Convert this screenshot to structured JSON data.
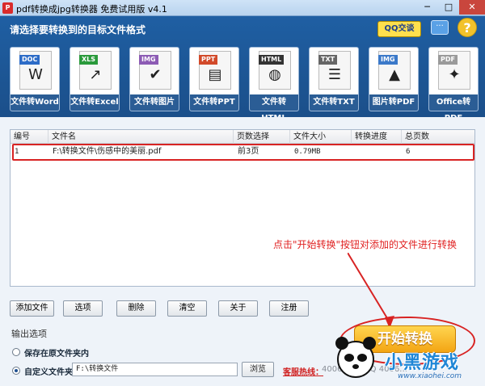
{
  "window": {
    "title": "pdf转换成jpg转换器 免费试用版 v4.1",
    "app_icon": "pdf-app-icon",
    "minimize": "─",
    "maximize": "□",
    "close": "✕"
  },
  "header": {
    "prompt": "请选择要转换到的目标文件格式",
    "qq_button": "QQ交谈",
    "chat_icon": "speech-bubble-icon",
    "help_icon": "question-icon",
    "help_glyph": "?",
    "formats": [
      {
        "label": "文件转Word",
        "tag": "DOC",
        "tag_color": "#2d6cc7",
        "icon": "word-doc-icon",
        "glyph": "W"
      },
      {
        "label": "文件转Excel",
        "tag": "XLS",
        "tag_color": "#2a9a3b",
        "icon": "excel-chart-icon",
        "glyph": "↗"
      },
      {
        "label": "文件转图片",
        "tag": "IMG",
        "tag_color": "#8c5bb4",
        "icon": "image-check-icon",
        "glyph": "✔"
      },
      {
        "label": "文件转PPT",
        "tag": "PPT",
        "tag_color": "#d24a2a",
        "icon": "ppt-slide-icon",
        "glyph": "▤"
      },
      {
        "label": "文件转HTML",
        "tag": "HTML",
        "tag_color": "#333333",
        "icon": "html-globe-icon",
        "glyph": "◍"
      },
      {
        "label": "文件转TXT",
        "tag": "TXT",
        "tag_color": "#666666",
        "icon": "txt-document-icon",
        "glyph": "☰"
      },
      {
        "label": "图片转PDF",
        "tag": "IMG",
        "tag_color": "#3b79c9",
        "icon": "image-to-pdf-icon",
        "glyph": "▲"
      },
      {
        "label": "Office转PDF",
        "tag": "PDF",
        "tag_color": "#9a9a9a",
        "icon": "office-to-pdf-icon",
        "glyph": "✦"
      }
    ]
  },
  "table": {
    "columns": [
      "编号",
      "文件名",
      "页数选择",
      "文件大小",
      "转换进度",
      "总页数"
    ],
    "rows": [
      {
        "id": "1",
        "filename": "F:\\转换文件\\伤感中的美丽.pdf",
        "pages": "前3页",
        "size": "0.79MB",
        "progress": "",
        "total": "6"
      }
    ]
  },
  "annotation": "点击\"开始转换\"按钮对添加的文件进行转换",
  "buttons": {
    "add": "添加文件",
    "options": "选项",
    "delete": "删除",
    "clear": "清空",
    "about": "关于",
    "register": "注册",
    "browse": "浏览",
    "start": "开始转换"
  },
  "output": {
    "title": "输出选项",
    "option_original": "保存在原文件夹内",
    "option_custom": "自定义文件夹",
    "selected": "custom",
    "path": "F:\\转换文件"
  },
  "footer": {
    "hotline_label": "客服热线：",
    "hotline_number": "4006…5…QQ 4006…",
    "brand": "小黑游戏",
    "brand_url": "www.xiaohei.com"
  },
  "colors": {
    "header_blue": "#1f5fa3",
    "highlight_red": "#d82323",
    "start_orange": "#f3a514"
  }
}
